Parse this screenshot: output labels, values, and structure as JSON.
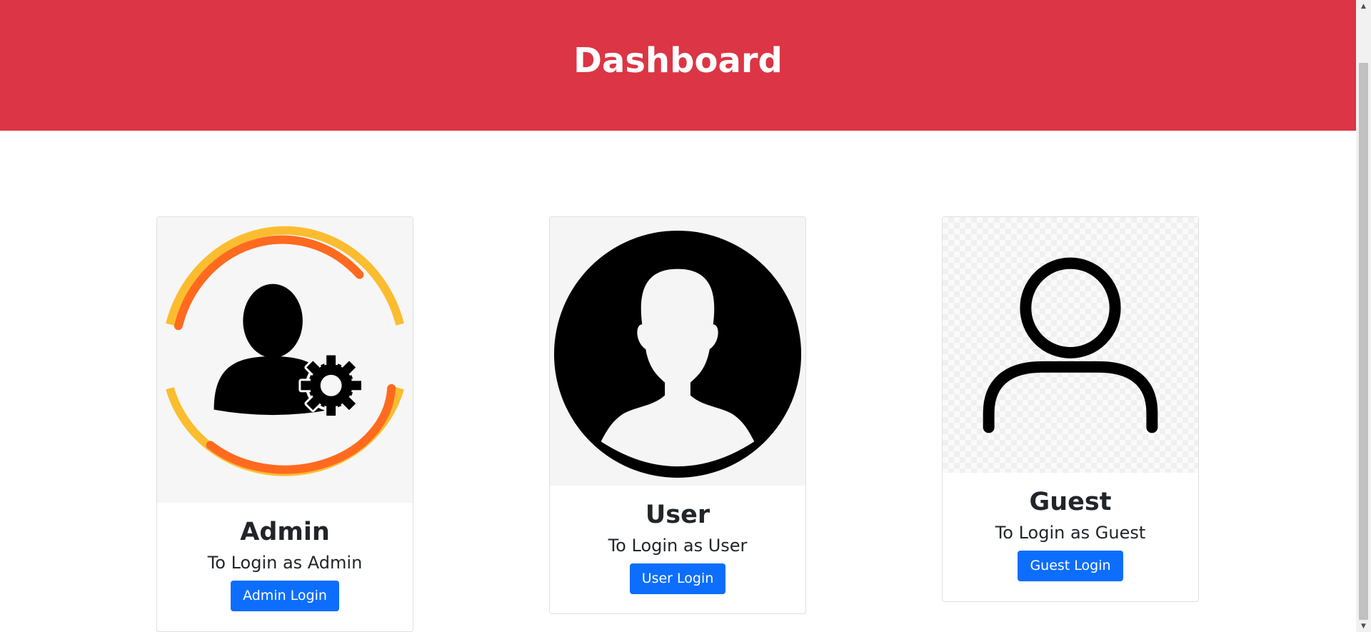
{
  "header": {
    "title": "Dashboard"
  },
  "colors": {
    "header_bg": "#dc3545",
    "button_bg": "#0d6efd",
    "admin_arc_orange": "#ff6a1f",
    "admin_arc_yellow": "#fbbd2f"
  },
  "cards": [
    {
      "title": "Admin",
      "text": "To Login as Admin",
      "button_label": "Admin Login",
      "icon": "admin-gear-icon"
    },
    {
      "title": "User",
      "text": "To Login as User",
      "button_label": "User Login",
      "icon": "user-silhouette-icon"
    },
    {
      "title": "Guest",
      "text": "To Login as Guest",
      "button_label": "Guest Login",
      "icon": "guest-outline-icon"
    }
  ]
}
